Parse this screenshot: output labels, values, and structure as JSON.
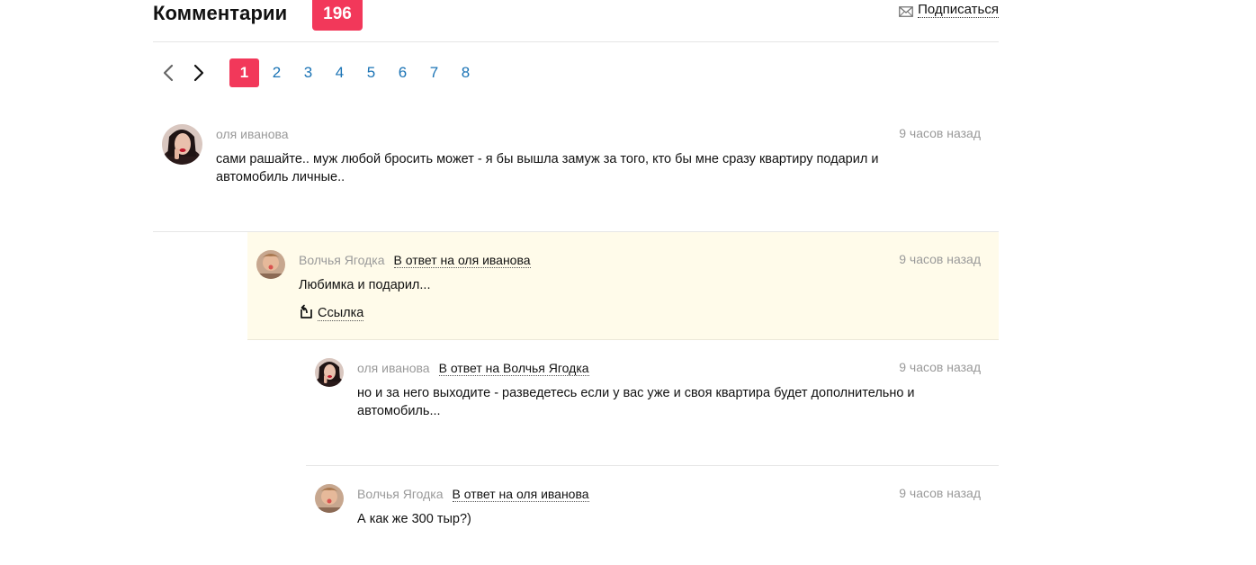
{
  "header": {
    "title": "Комментарии",
    "count": "196",
    "subscribe_label": "Подписаться",
    "subscribe_icon": "mail-icon"
  },
  "pagination": {
    "prev_icon": "chevron-left-icon",
    "next_icon": "chevron-right-icon",
    "pages": [
      "1",
      "2",
      "3",
      "4",
      "5",
      "6",
      "7",
      "8"
    ],
    "current": "1"
  },
  "comments": [
    {
      "author": "оля иванова",
      "reply_to": "",
      "time": "9 часов назад",
      "text": "сами рашайте.. муж любой бросить может - я бы вышла замуж за того, кто бы мне сразу квартиру подарил и автомобиль личные..",
      "link": ""
    },
    {
      "author": "Волчья Ягодка",
      "reply_to": "В ответ на оля иванова",
      "time": "9 часов назад",
      "text": "Любимка и подарил...",
      "link": "Ссылка"
    },
    {
      "author": "оля иванова",
      "reply_to": "В ответ на Волчья Ягодка",
      "time": "9 часов назад",
      "text": "но и за него выходите - разведетесь если у вас уже и своя квартира будет дополнительно и автомобиль...",
      "link": ""
    },
    {
      "author": "Волчья Ягодка",
      "reply_to": "В ответ на оля иванова",
      "time": "9 часов назад",
      "text": "А как же 300 тыр?)",
      "link": ""
    }
  ],
  "colors": {
    "accent": "#f2385a",
    "page_link": "#1a73b5",
    "highlight_bg": "#fffbea",
    "muted": "#9a9a9a"
  }
}
